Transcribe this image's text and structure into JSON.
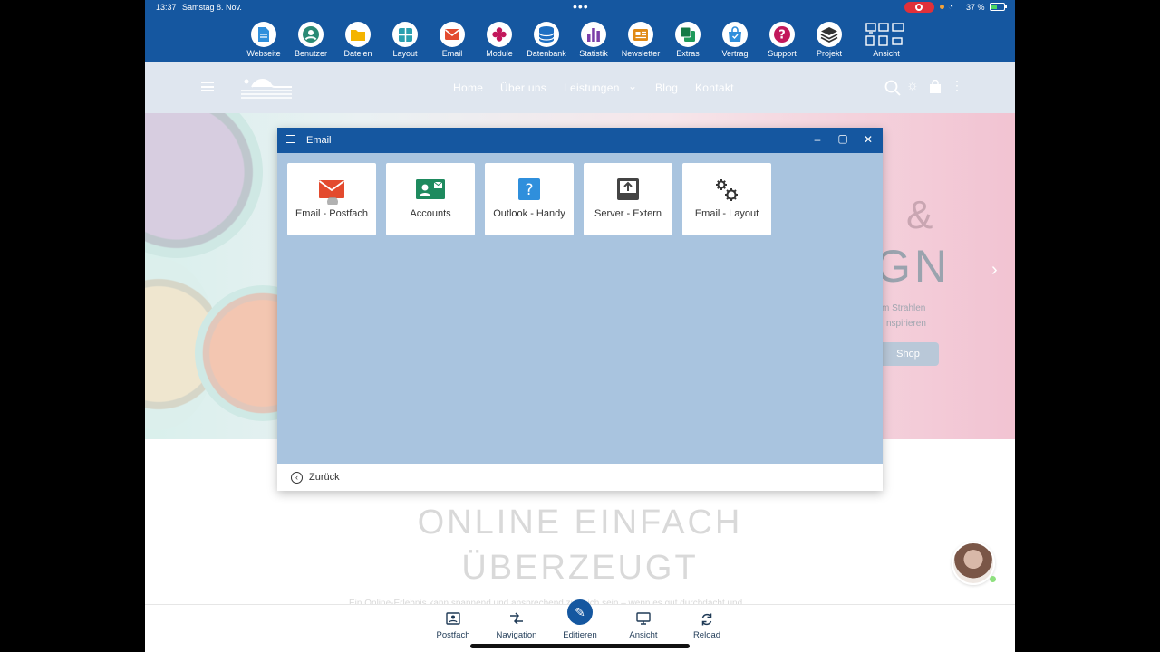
{
  "status_bar": {
    "time": "13:37",
    "date": "Samstag 8. Nov.",
    "battery": "37 %"
  },
  "toolbar": {
    "items": [
      {
        "label": "Webseite",
        "icon": "document-icon",
        "color": "#2f8fdc"
      },
      {
        "label": "Benutzer",
        "icon": "user-icon",
        "color": "#2a8a74"
      },
      {
        "label": "Dateien",
        "icon": "folder-icon",
        "color": "#f4b400"
      },
      {
        "label": "Layout",
        "icon": "layout-icon",
        "color": "#2aa0b0"
      },
      {
        "label": "Email",
        "icon": "mail-icon",
        "color": "#e34a2e"
      },
      {
        "label": "Module",
        "icon": "puzzle-icon",
        "color": "#c2185b"
      },
      {
        "label": "Datenbank",
        "icon": "database-icon",
        "color": "#1e6fc2"
      },
      {
        "label": "Statistik",
        "icon": "bar-chart-icon",
        "color": "#7b3fa8"
      },
      {
        "label": "Newsletter",
        "icon": "newsletter-icon",
        "color": "#e08a16"
      },
      {
        "label": "Extras",
        "icon": "extras-icon",
        "color": "#1f9a5a"
      },
      {
        "label": "Vertrag",
        "icon": "bag-icon",
        "color": "#2f8fdc"
      },
      {
        "label": "Support",
        "icon": "help-icon",
        "color": "#c2185b"
      },
      {
        "label": "Projekt",
        "icon": "layers-icon",
        "color": "#333333"
      },
      {
        "label": "Ansicht",
        "icon": "devices-icon",
        "color": "#ffffff"
      }
    ]
  },
  "site_nav": {
    "links": [
      "Home",
      "Über uns",
      "Leistungen",
      "Blog",
      "Kontakt"
    ]
  },
  "hero": {
    "amp": "&",
    "big": "GN",
    "sub1": "m Strahlen",
    "sub2": "nspirieren",
    "shop": "Shop"
  },
  "content": {
    "headline1": "ONLINE EINFACH",
    "headline2": "ÜBERZEUGT",
    "body": "Ein Online-Erlebnis kann spannend und ansprechend zugleich sein – wenn es gut durchdacht und"
  },
  "dialog": {
    "title": "Email",
    "tiles": [
      {
        "label": "Email - Postfach",
        "icon": "mail-icon"
      },
      {
        "label": "Accounts",
        "icon": "contact-card-icon"
      },
      {
        "label": "Outlook - Handy",
        "icon": "question-icon"
      },
      {
        "label": "Server - Extern",
        "icon": "upload-tray-icon"
      },
      {
        "label": "Email - Layout",
        "icon": "gears-icon"
      }
    ],
    "back_label": "Zurück"
  },
  "bottom_bar": {
    "items": [
      {
        "label": "Postfach",
        "icon": "inbox-icon"
      },
      {
        "label": "Navigation",
        "icon": "navigation-icon"
      },
      {
        "label": "Editieren",
        "icon": "edit-icon"
      },
      {
        "label": "Ansicht",
        "icon": "monitor-icon"
      },
      {
        "label": "Reload",
        "icon": "reload-icon"
      }
    ]
  }
}
